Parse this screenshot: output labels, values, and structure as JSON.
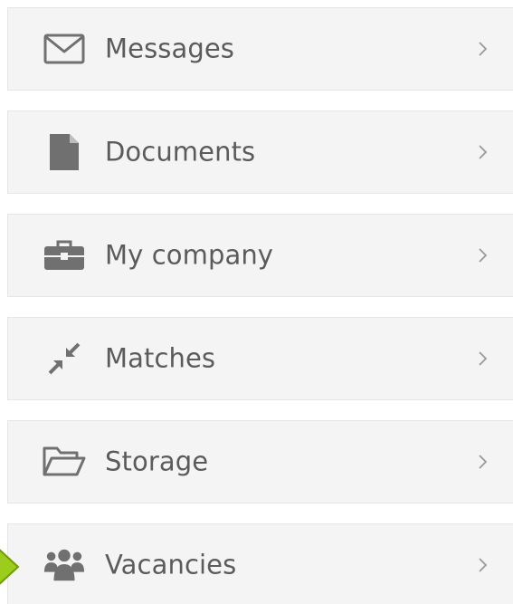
{
  "menu": {
    "items": [
      {
        "label": "Messages",
        "icon": "envelope-icon"
      },
      {
        "label": "Documents",
        "icon": "document-icon"
      },
      {
        "label": "My company",
        "icon": "briefcase-icon"
      },
      {
        "label": "Matches",
        "icon": "compress-arrows-icon"
      },
      {
        "label": "Storage",
        "icon": "folder-open-icon"
      },
      {
        "label": "Vacancies",
        "icon": "users-icon"
      }
    ]
  },
  "colors": {
    "item_background": "#f4f4f4",
    "item_border": "#e6e6e6",
    "label_text": "#5b5b5b",
    "icon": "#707070",
    "chevron": "#9a9a9a",
    "pointer_arrow": "#9ccc1c"
  }
}
